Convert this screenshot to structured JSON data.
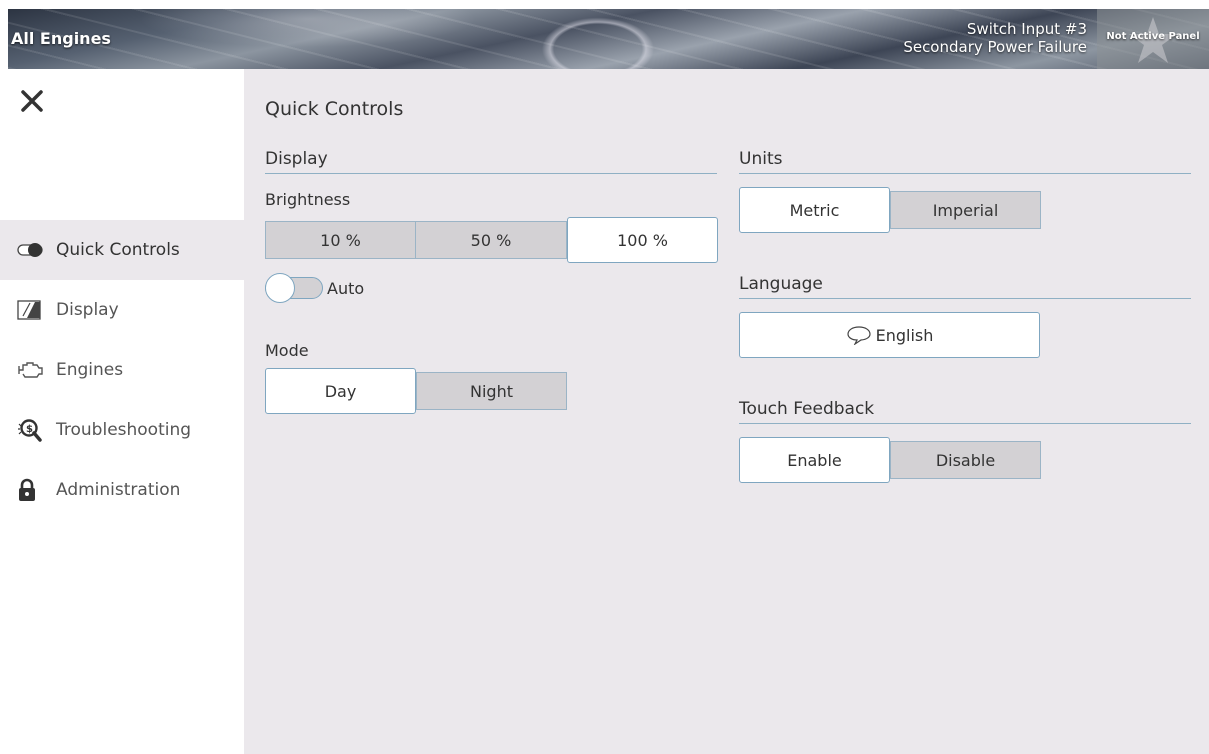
{
  "header": {
    "title": "All Engines",
    "status_line1": "Switch Input #3",
    "status_line2": "Secondary Power Failure",
    "panel_label": "Not Active Panel"
  },
  "sidebar": {
    "close_icon": "close-icon",
    "items": [
      {
        "label": "Quick Controls",
        "icon": "toggle-icon",
        "active": true
      },
      {
        "label": "Display",
        "icon": "display-icon",
        "active": false
      },
      {
        "label": "Engines",
        "icon": "engine-icon",
        "active": false
      },
      {
        "label": "Troubleshooting",
        "icon": "troubleshooting-icon",
        "active": false
      },
      {
        "label": "Administration",
        "icon": "lock-icon",
        "active": false
      }
    ]
  },
  "main": {
    "title": "Quick Controls",
    "display": {
      "heading": "Display",
      "brightness_label": "Brightness",
      "brightness_options": [
        "10 %",
        "50 %",
        "100 %"
      ],
      "brightness_selected": "100 %",
      "auto_label": "Auto",
      "auto_on": false,
      "mode_label": "Mode",
      "mode_options": [
        "Day",
        "Night"
      ],
      "mode_selected": "Day"
    },
    "units": {
      "heading": "Units",
      "options": [
        "Metric",
        "Imperial"
      ],
      "selected": "Metric"
    },
    "language": {
      "heading": "Language",
      "value": "English",
      "icon": "speech-bubble-icon"
    },
    "touch_feedback": {
      "heading": "Touch Feedback",
      "options": [
        "Enable",
        "Disable"
      ],
      "selected": "Enable"
    }
  },
  "colors": {
    "main_background": "#ebe8ec",
    "accent_border": "#7fa6c0",
    "unselected_button": "#d3d1d4",
    "selected_button": "#ffffff"
  }
}
